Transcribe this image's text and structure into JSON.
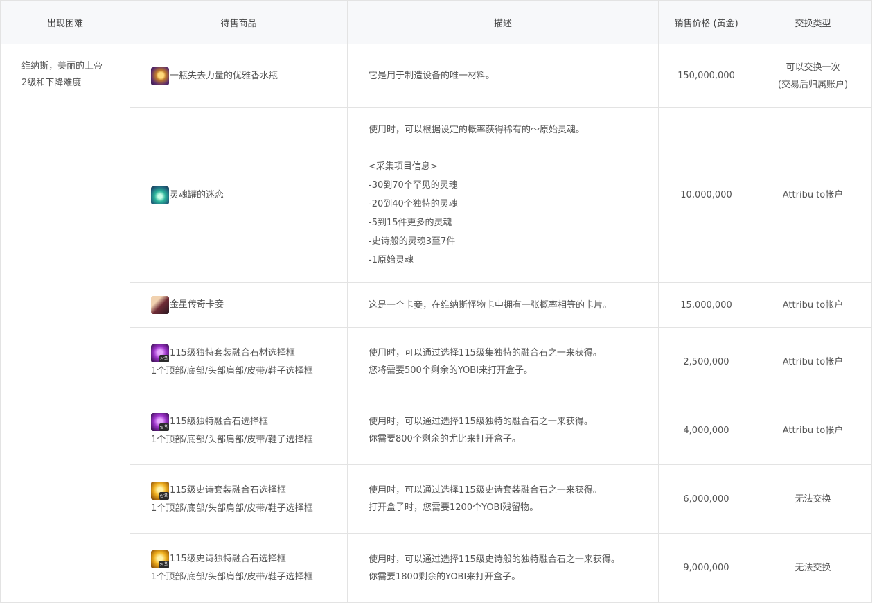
{
  "headers": {
    "difficulty": "出现困难",
    "item": "待售商品",
    "description": "描述",
    "price": "销售价格 (黄金)",
    "trade": "交换类型"
  },
  "difficulty": {
    "line1": "维纳斯，美丽的上帝",
    "line2": "2级和下降难度"
  },
  "rows": [
    {
      "icon": "perfume-bottle-icon",
      "name": "一瓶失去力量的优雅香水瓶",
      "desc": [
        "它是用于制造设备的唯一材料。"
      ],
      "price": "150,000,000",
      "trade": [
        "可以交换一次",
        "(交易后归属账户)"
      ]
    },
    {
      "icon": "soul-urn-icon",
      "name": "灵魂罐的迷恋",
      "desc_intro": "使用时，可以根据设定的概率获得稀有的～原始灵魂。",
      "desc_list": [
        "<采集项目信息>",
        "-30到70个罕见的灵魂",
        "-20到40个独特的灵魂",
        "-5到15件更多的灵魂",
        "-史诗般的灵魂3至7件",
        "-1原始灵魂"
      ],
      "price": "10,000,000",
      "trade": [
        "Attribu to帐户"
      ]
    },
    {
      "icon": "card-pack-icon",
      "name": "金星传奇卡妾",
      "desc": [
        "这是一个卡妾，在维纳斯怪物卡中拥有一张概率相等的卡片。"
      ],
      "price": "15,000,000",
      "trade": [
        "Attribu to帐户"
      ]
    },
    {
      "icon": "purple-box-icon",
      "icon_tag": "상의",
      "name": "115级独特套装融合石材选择框",
      "sub": "1个顶部/底部/头部肩部/皮带/鞋子选择框",
      "desc": [
        "使用时，可以通过选择115级集独特的融合石之一来获得。",
        "您将需要500个剩余的YOBI来打开盒子。"
      ],
      "price": "2,500,000",
      "trade": [
        "Attribu to帐户"
      ]
    },
    {
      "icon": "purple-box-icon",
      "icon_tag": "상의",
      "name": "115级独特融合石选择框",
      "sub": "1个顶部/底部/头部肩部/皮带/鞋子选择框",
      "desc": [
        "使用时，可以通过选择115级独特的融合石之一来获得。",
        "你需要800个剩余的尤比来打开盒子。"
      ],
      "price": "4,000,000",
      "trade": [
        "Attribu to帐户"
      ]
    },
    {
      "icon": "gold-box-icon",
      "icon_tag": "상의",
      "name": "115级史诗套装融合石选择框",
      "sub": "1个顶部/底部/头部肩部/皮带/鞋子选择框",
      "desc": [
        "使用时，可以通过选择115级史诗套装融合石之一来获得。",
        "打开盒子时，您需要1200个YOBI残留物。"
      ],
      "price": "6,000,000",
      "trade": [
        "无法交换"
      ]
    },
    {
      "icon": "gold-box-icon",
      "icon_tag": "상의",
      "name": "115级史诗独特融合石选择框",
      "sub": "1个顶部/底部/头部肩部/皮带/鞋子选择框",
      "desc": [
        "使用时，可以通过选择115级史诗般的独特融合石之一来获得。",
        "你需要1800剩余的YOBI来打开盒子。"
      ],
      "price": "9,000,000",
      "trade": [
        "无法交换"
      ]
    }
  ]
}
